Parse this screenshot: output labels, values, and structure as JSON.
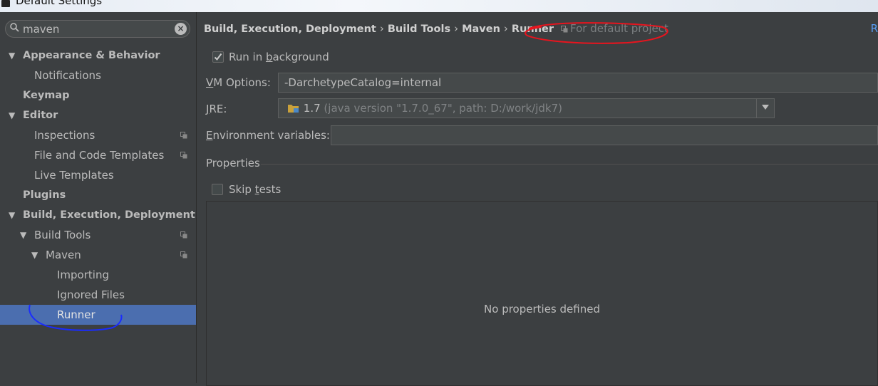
{
  "window": {
    "title": "Default Settings"
  },
  "search": {
    "value": "maven"
  },
  "tree": [
    {
      "label": "Appearance & Behavior",
      "bold": true,
      "indent": 0,
      "expanded": true
    },
    {
      "label": "Notifications",
      "bold": false,
      "indent": 1
    },
    {
      "label": "Keymap",
      "bold": true,
      "indent": 0
    },
    {
      "label": "Editor",
      "bold": true,
      "indent": 0,
      "expanded": true
    },
    {
      "label": "Inspections",
      "bold": false,
      "indent": 1,
      "project_icon": true
    },
    {
      "label": "File and Code Templates",
      "bold": false,
      "indent": 1,
      "project_icon": true
    },
    {
      "label": "Live Templates",
      "bold": false,
      "indent": 1
    },
    {
      "label": "Plugins",
      "bold": true,
      "indent": 0
    },
    {
      "label": "Build, Execution, Deployment",
      "bold": true,
      "indent": 0,
      "expanded": true
    },
    {
      "label": "Build Tools",
      "bold": false,
      "indent": 1,
      "expanded": true,
      "project_icon": true
    },
    {
      "label": "Maven",
      "bold": false,
      "indent": 2,
      "expanded": true,
      "project_icon": true
    },
    {
      "label": "Importing",
      "bold": false,
      "indent": 3
    },
    {
      "label": "Ignored Files",
      "bold": false,
      "indent": 3
    },
    {
      "label": "Runner",
      "bold": false,
      "indent": 3,
      "selected": true
    }
  ],
  "breadcrumb": {
    "items": [
      "Build, Execution, Deployment",
      "Build Tools",
      "Maven",
      "Runner"
    ],
    "separator": "›",
    "scope": "For default project",
    "reset_label": "R"
  },
  "runner": {
    "run_in_background": {
      "label_pre": "Run in ",
      "label_u": "b",
      "label_post": "ackground",
      "checked": true
    },
    "vm_options": {
      "label_u": "V",
      "label_post": "M Options:",
      "value": "-DarchetypeCatalog=internal"
    },
    "jre": {
      "label_u": "J",
      "label_post": "RE:",
      "version": "1.7",
      "detail": "(java version \"1.7.0_67\", path: D:/work/jdk7)"
    },
    "env": {
      "label_u": "E",
      "label_post": "nvironment variables:",
      "value": ""
    },
    "properties_title": "Properties",
    "skip_tests": {
      "label_pre": "Skip ",
      "label_u": "t",
      "label_post": "ests",
      "checked": false
    },
    "no_properties": "No properties defined"
  },
  "colors": {
    "background": "#3c3f41",
    "selection": "#4b6eaf",
    "text": "#bbbbbb",
    "annotation_red": "#e8141e",
    "annotation_blue": "#1a2cff",
    "link": "#589df6"
  }
}
